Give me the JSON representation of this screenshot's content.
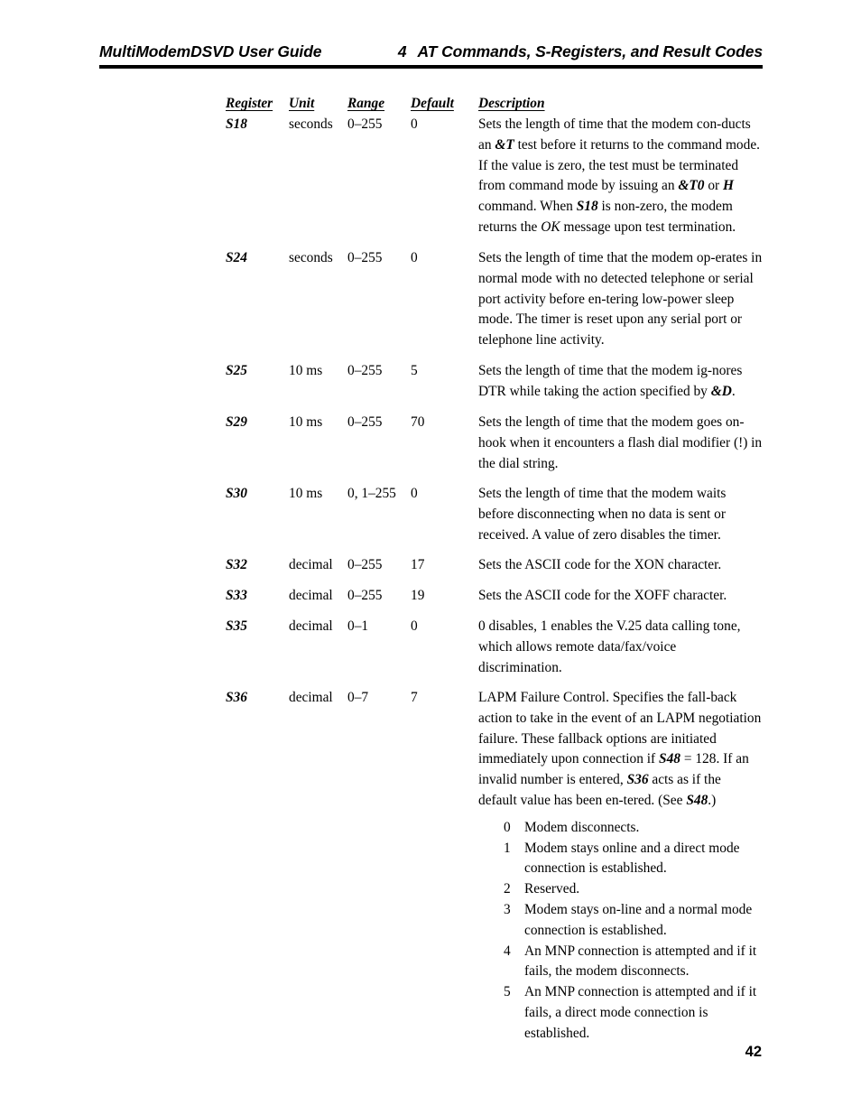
{
  "running_head": {
    "left": "MultiModemDSVD User Guide",
    "chapter_number": "4",
    "chapter_title": "AT Commands, S-Registers, and Result Codes"
  },
  "table": {
    "headers": {
      "register": "Register",
      "unit": "Unit",
      "range": "Range",
      "default": "Default",
      "description": "Description"
    },
    "rows": [
      {
        "register": "S18",
        "unit": "seconds",
        "range": "0–255",
        "default": "0",
        "description": "Sets the length of time that the modem conducts an &T test before it returns to the command mode. If the value is zero, the test must be terminated from command mode by issuing an &T0 or H command. When S18 is non-zero, the modem returns the OK message upon test termination.",
        "desc_parts": [
          {
            "t": "Sets the length of time that the modem con-ducts an ",
            "s": "plain"
          },
          {
            "t": "&T",
            "s": "cmd"
          },
          {
            "t": " test before it returns to the command mode. If the value is zero, the test must be terminated from command mode by issuing an ",
            "s": "plain"
          },
          {
            "t": "&T0",
            "s": "cmd"
          },
          {
            "t": " or ",
            "s": "plain"
          },
          {
            "t": "H",
            "s": "cmd"
          },
          {
            "t": " command. When ",
            "s": "plain"
          },
          {
            "t": "S18",
            "s": "reg"
          },
          {
            "t": " is non-zero, the modem returns the ",
            "s": "plain"
          },
          {
            "t": "OK",
            "s": "lit"
          },
          {
            "t": " message upon test termination.",
            "s": "plain"
          }
        ]
      },
      {
        "register": "S24",
        "unit": "seconds",
        "range": "0–255",
        "default": "0",
        "description": "Sets the length of time that the modem operates in normal mode with no detected telephone or serial port activity before entering low-power sleep mode. The timer is reset upon any serial port or telephone line activity.",
        "desc_parts": [
          {
            "t": "Sets the length of time that the modem op-erates in normal mode with no detected telephone or serial port activity before en-tering low-power sleep mode. The timer is reset upon any serial port or telephone line activity.",
            "s": "plain"
          }
        ]
      },
      {
        "register": "S25",
        "unit": "10 ms",
        "range": "0–255",
        "default": "5",
        "description": "Sets the length of time that the modem ignores DTR while taking the action specified by &D.",
        "desc_parts": [
          {
            "t": "Sets the length of time that the modem ig-nores DTR while taking the action specified by ",
            "s": "plain"
          },
          {
            "t": "&D",
            "s": "cmd"
          },
          {
            "t": ".",
            "s": "plain"
          }
        ]
      },
      {
        "register": "S29",
        "unit": "10 ms",
        "range": "0–255",
        "default": "70",
        "description": "Sets the length of time that the modem goes on-hook when it encounters a flash dial modifier (!) in the dial string.",
        "desc_parts": [
          {
            "t": "Sets the length of time that the modem goes on-hook when it encounters a flash dial modifier (!) in the dial string.",
            "s": "plain"
          }
        ]
      },
      {
        "register": "S30",
        "unit": "10 ms",
        "range": "0, 1–255",
        "default": "0",
        "description": "Sets the length of time that the modem waits before disconnecting when no data is sent or received. A value of zero disables the timer.",
        "desc_parts": [
          {
            "t": "Sets the length of time that the modem waits before disconnecting when no data is sent or received. A value of zero disables the timer.",
            "s": "plain"
          }
        ]
      },
      {
        "register": "S32",
        "unit": "decimal",
        "range": "0–255",
        "default": "17",
        "description": "Sets the ASCII code for the XON character.",
        "desc_parts": [
          {
            "t": "Sets the ASCII code for the XON character.",
            "s": "plain"
          }
        ]
      },
      {
        "register": "S33",
        "unit": "decimal",
        "range": "0–255",
        "default": "19",
        "description": "Sets the ASCII code for the XOFF character.",
        "desc_parts": [
          {
            "t": "Sets the ASCII code for the XOFF character.",
            "s": "plain"
          }
        ]
      },
      {
        "register": "S35",
        "unit": "decimal",
        "range": "0–1",
        "default": "0",
        "description": "0 disables, 1 enables the V.25 data calling tone, which allows remote data/fax/voice discrimination.",
        "desc_parts": [
          {
            "t": "0 disables, 1 enables the V.25 data calling tone, which allows remote data/fax/voice discrimination.",
            "s": "plain"
          }
        ]
      },
      {
        "register": "S36",
        "unit": "decimal",
        "range": "0–7",
        "default": "7",
        "description": "LAPM Failure Control. Specifies the fallback action to take in the event of an LAPM negotiation failure. These fallback options are initiated immediately upon connection if S48 = 128. If an invalid number is entered, S36 acts as if the default value has been entered. (See S48.)",
        "desc_parts": [
          {
            "t": "LAPM Failure Control. Specifies the fall-back action to take in the event of an LAPM negotiation failure. These fallback options are initiated immediately upon connection if ",
            "s": "plain"
          },
          {
            "t": "S48",
            "s": "reg"
          },
          {
            "t": " = 128. If an invalid number is entered, ",
            "s": "plain"
          },
          {
            "t": "S36",
            "s": "reg"
          },
          {
            "t": " acts as if the default value has been en-tered. (See ",
            "s": "plain"
          },
          {
            "t": "S48",
            "s": "reg"
          },
          {
            "t": ".)",
            "s": "plain"
          }
        ],
        "options": [
          {
            "value": "0",
            "text": "Modem disconnects."
          },
          {
            "value": "1",
            "text": "Modem stays online and a direct mode connection is established."
          },
          {
            "value": "2",
            "text": "Reserved."
          },
          {
            "value": "3",
            "text": "Modem stays on-line and a normal mode connection is established."
          },
          {
            "value": "4",
            "text": "An MNP connection is attempted and if it fails, the modem disconnects."
          },
          {
            "value": "5",
            "text": "An MNP connection is attempted and if it fails, a direct mode connection is established."
          }
        ]
      }
    ]
  },
  "folio": {
    "page_number": "42"
  }
}
